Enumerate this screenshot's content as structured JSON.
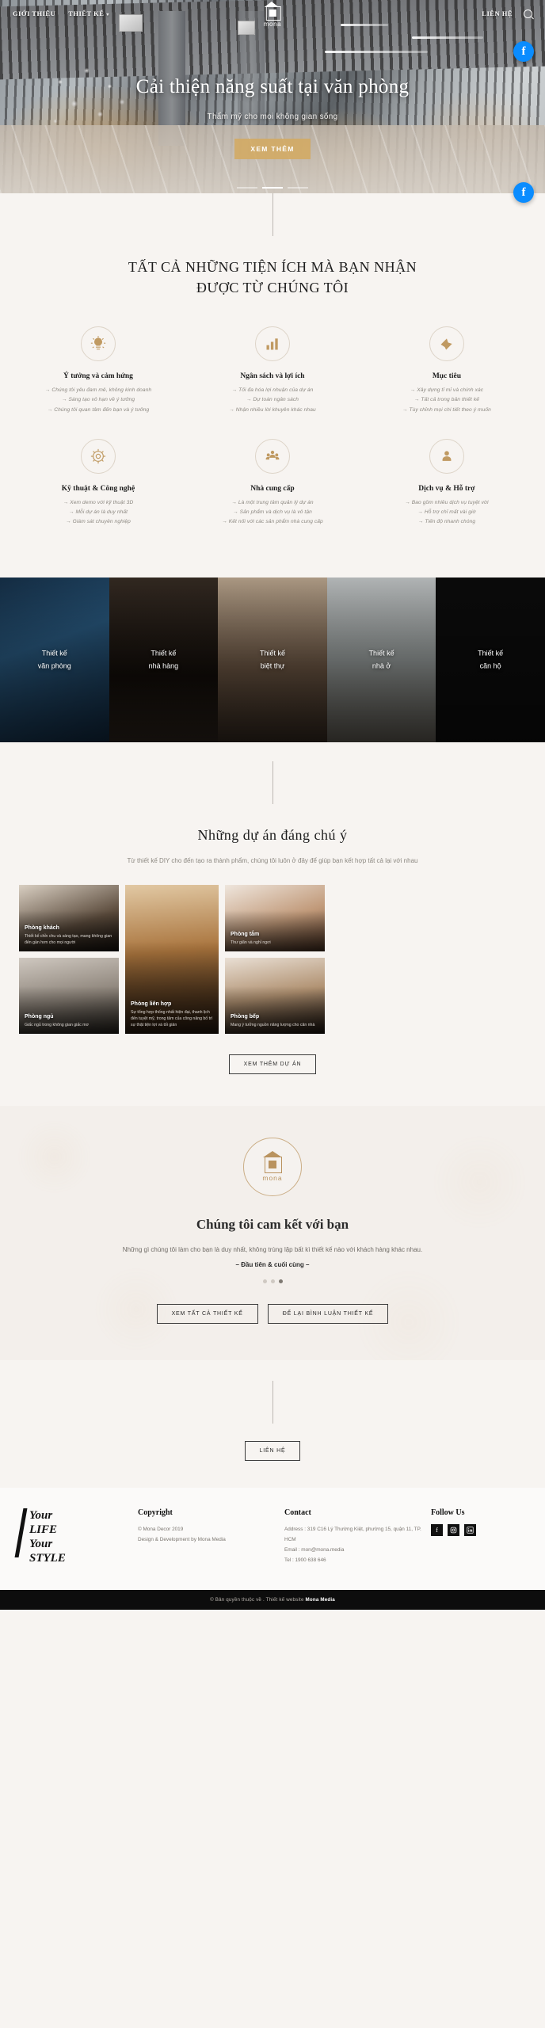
{
  "header": {
    "nav_left": [
      {
        "label": "GIỚI THIỆU",
        "has_caret": false
      },
      {
        "label": "THIẾT KẾ",
        "has_caret": true
      }
    ],
    "nav_right": [
      {
        "label": "LIÊN HỆ"
      }
    ],
    "search_icon": "search-icon",
    "brand": {
      "name": "mona",
      "icon": "house-logo-icon"
    }
  },
  "hero": {
    "title": "Cải thiện năng suất tại văn phòng",
    "subtitle": "Thẩm mỹ cho mọi không gian sống",
    "button": "XEM THÊM",
    "slides": 3,
    "active_slide": 2
  },
  "chat": {
    "icon": "facebook-messenger-icon",
    "color": "#0a8cff"
  },
  "features": {
    "title_line1": "TẤT CẢ NHỮNG TIỆN ÍCH MÀ BẠN NHẬN",
    "title_line2": "ĐƯỢC TỪ CHÚNG TÔI",
    "items": [
      {
        "icon": "lightbulb-icon",
        "name": "Ý tưởng và cảm hứng",
        "lines": [
          "→ Chúng tôi yêu đam mê, không kinh doanh",
          "→ Sáng tạo vô hạn về ý tưởng",
          "→ Chúng tôi quan tâm đến bạn và ý tưởng"
        ]
      },
      {
        "icon": "bar-chart-icon",
        "name": "Ngân sách và lợi ích",
        "lines": [
          "→ Tối đa hóa lợi nhuận của dự án",
          "→ Dự toán ngân sách",
          "→ Nhận nhiều lời khuyên khác nhau"
        ]
      },
      {
        "icon": "target-dart-icon",
        "name": "Mục tiêu",
        "lines": [
          "→ Xây dựng tỉ mỉ và chính xác",
          "→ Tất cả trong bản thiết kế",
          "→ Tùy chỉnh mọi chi tiết theo ý muốn"
        ]
      },
      {
        "icon": "gear-tech-icon",
        "name": "Kỹ thuật & Công nghệ",
        "lines": [
          "→ Xem demo với kỹ thuật 3D",
          "→ Mỗi dự án là duy nhất",
          "→ Giám sát chuyên nghiệp"
        ]
      },
      {
        "icon": "group-people-icon",
        "name": "Nhà cung cấp",
        "lines": [
          "→ Là một trung tâm quản lý dự án",
          "→ Sản phẩm và dịch vụ là vô tận",
          "→ Kết nối với các sản phẩm nhà cung cấp"
        ]
      },
      {
        "icon": "support-agent-icon",
        "name": "Dịch vụ & Hỗ trợ",
        "lines": [
          "→ Bao gồm nhiều dịch vụ tuyệt vời",
          "→ Hỗ trợ chỉ mất vài giờ",
          "→ Tiến độ nhanh chóng"
        ]
      }
    ]
  },
  "categories": [
    {
      "line1": "Thiết kế",
      "line2": "văn phòng"
    },
    {
      "line1": "Thiết kế",
      "line2": "nhà hàng"
    },
    {
      "line1": "Thiết kế",
      "line2": "biệt thự"
    },
    {
      "line1": "Thiết kế",
      "line2": "nhà ở"
    },
    {
      "line1": "Thiết kế",
      "line2": "căn hộ"
    }
  ],
  "projects": {
    "title": "Những dự án đáng chú ý",
    "subtitle": "Từ thiết kế DIY cho đến tạo ra thành phẩm, chúng tôi luôn ở đây để giúp bạn kết hợp tất cả lại với nhau",
    "button": "XEM THÊM DỰ ÁN",
    "cards": [
      {
        "title": "Phòng khách",
        "desc": "Thiết kế chỉn chu và sáng tạo, mang không gian đến gần hơn cho mọi người"
      },
      {
        "title": "Phòng ngủ",
        "desc": "Giấc ngủ trong không gian giấc mơ"
      },
      {
        "title": "Phòng liên hợp",
        "desc": "Sự tổng hợp thống nhất hiện đại, thanh lịch đến tuyệt mỹ, trong tâm của công năng bố trí sự thật tiện lợi và tối giản"
      },
      {
        "title": "Phòng tắm",
        "desc": "Thư giãn và nghỉ ngơi"
      },
      {
        "title": "Phòng bếp",
        "desc": "Mang ý tưởng nguồn năng lượng cho căn nhà"
      }
    ]
  },
  "commit": {
    "logo_text": "mona",
    "title": "Chúng tôi cam kết với bạn",
    "paragraph": "Những gì chúng tôi làm cho bạn là duy nhất, không trùng lặp bất kì thiết kế nào với khách hàng khác nhau.",
    "signature": "– Đầu tiên & cuối cùng –",
    "dots": 3,
    "active_dot": 3,
    "buttons": [
      "XEM TẤT CẢ THIẾT KẾ",
      "ĐỂ LẠI BÌNH LUẬN THIẾT KẾ"
    ]
  },
  "contact_section": {
    "button": "LIÊN HỆ"
  },
  "footer": {
    "logo_lines": [
      "Your",
      "LIFE",
      "Your",
      "STYLE"
    ],
    "columns": [
      {
        "heading": "Copyright",
        "lines": [
          "© Mona Decor 2019",
          "Design & Development by Mona Media"
        ]
      },
      {
        "heading": "Contact",
        "lines": [
          "Address : 319 C16 Lý Thường Kiệt, phường 15, quận 11, TP. HCM",
          "Email : mon@mona.media",
          "Tel : 1900 638 646"
        ]
      }
    ],
    "follow": {
      "heading": "Follow Us",
      "socials": [
        "facebook-icon",
        "instagram-icon",
        "linkedin-icon"
      ]
    },
    "copybar_pre": "© Bản quyền thuộc về . Thiết kế website",
    "copybar_brand": "Mona Media"
  },
  "colors": {
    "accent": "#d3aa62",
    "dark": "#0d0d0d",
    "page_bg": "#f7f4f1"
  }
}
